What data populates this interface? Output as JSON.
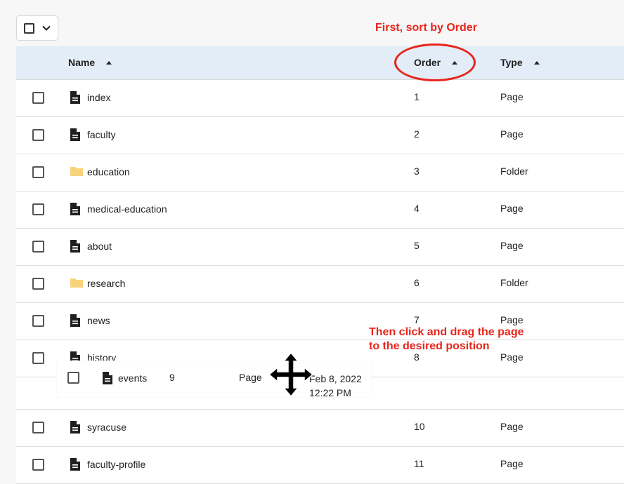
{
  "callouts": {
    "sort": "First, sort by Order",
    "drag_line1": "Then click and drag the page",
    "drag_line2": "to the desired position"
  },
  "columns": {
    "name": "Name",
    "order": "Order",
    "type": "Type"
  },
  "rows_top": [
    {
      "name": "index",
      "order": "1",
      "type": "Page",
      "icon": "page-icon"
    },
    {
      "name": "faculty",
      "order": "2",
      "type": "Page",
      "icon": "page-icon"
    },
    {
      "name": "education",
      "order": "3",
      "type": "Folder",
      "icon": "folder-icon"
    },
    {
      "name": "medical-education",
      "order": "4",
      "type": "Page",
      "icon": "page-icon"
    },
    {
      "name": "about",
      "order": "5",
      "type": "Page",
      "icon": "page-icon"
    },
    {
      "name": "research",
      "order": "6",
      "type": "Folder",
      "icon": "folder-icon"
    },
    {
      "name": "news",
      "order": "7",
      "type": "Page",
      "icon": "page-icon"
    },
    {
      "name": "history",
      "order": "8",
      "type": "Page",
      "icon": "page-icon"
    }
  ],
  "rows_bottom": [
    {
      "name": "syracuse",
      "order": "10",
      "type": "Page",
      "icon": "page-icon"
    },
    {
      "name": "faculty-profile",
      "order": "11",
      "type": "Page",
      "icon": "page-icon"
    }
  ],
  "dragging": {
    "name": "events",
    "order": "9",
    "type": "Page",
    "date": "Feb 8, 2022",
    "time": "12:22 PM",
    "icon": "page-icon"
  },
  "colors": {
    "accent_red": "#e8251b",
    "header_bg": "#e3edf7",
    "folder": "#f7d37c"
  }
}
